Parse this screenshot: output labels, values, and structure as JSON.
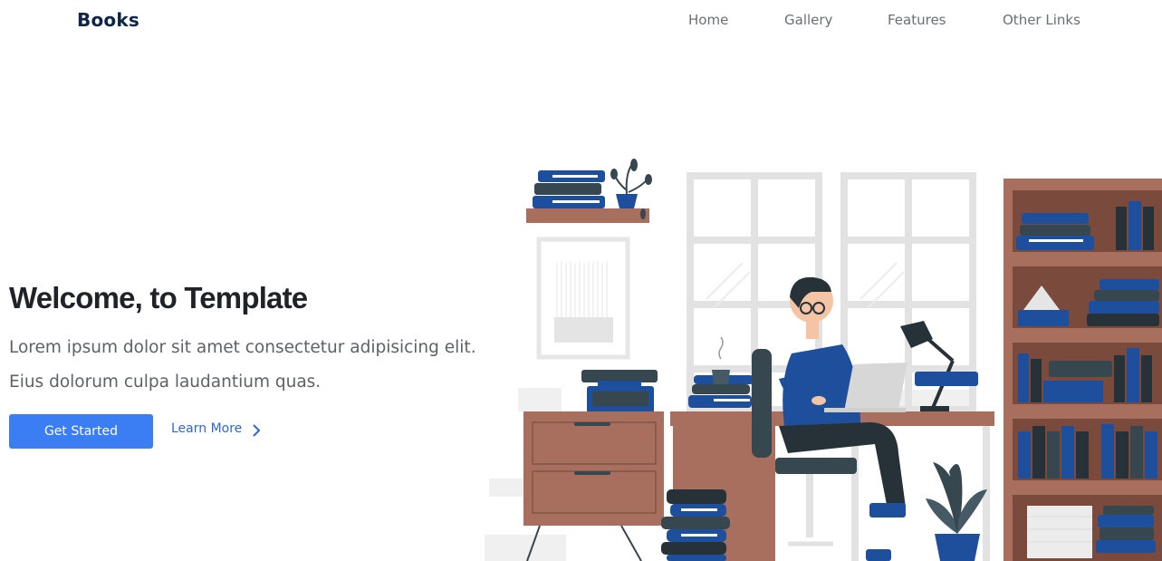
{
  "header": {
    "brand": "Books",
    "nav": [
      {
        "label": "Home"
      },
      {
        "label": "Gallery"
      },
      {
        "label": "Features"
      },
      {
        "label": "Other Links"
      }
    ]
  },
  "hero": {
    "title": "Welcome, to Template",
    "text": "Lorem ipsum dolor sit amet consectetur adipisicing elit. Eius dolorum culpa laudantium quas.",
    "primary_button": "Get Started",
    "secondary_link": "Learn More"
  },
  "colors": {
    "brand": "#0f2547",
    "accent": "#3b7df2",
    "link": "#2f66d6",
    "wood": "#a86f5e",
    "book_blue": "#1e4f9c"
  },
  "icons": {
    "secondary_link_icon": "chevron-right-icon"
  }
}
